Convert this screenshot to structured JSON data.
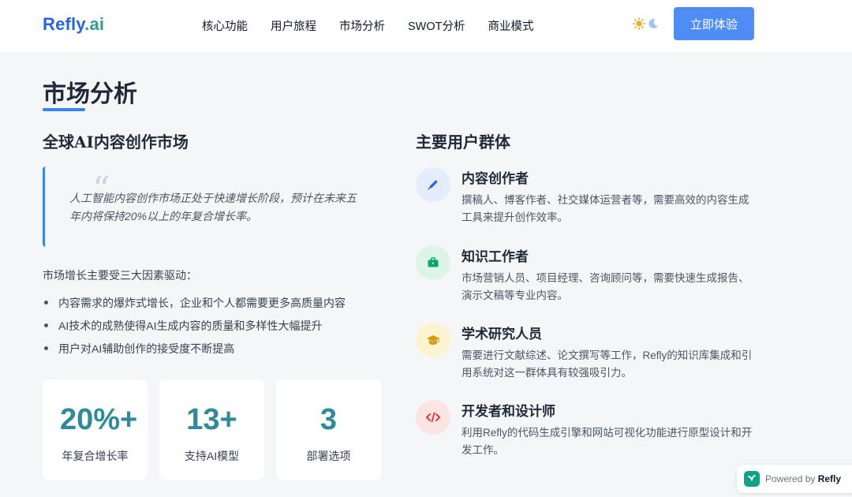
{
  "header": {
    "logo_main": "Refly",
    "logo_suffix": ".ai",
    "nav": [
      "核心功能",
      "用户旅程",
      "市场分析",
      "SWOT分析",
      "商业模式"
    ],
    "cta_label": "立即体验"
  },
  "section": {
    "title": "市场分析"
  },
  "market": {
    "heading": "全球AI内容创作市场",
    "quote": "人工智能内容创作市场正处于快速增长阶段，预计在未来五年内将保持20%以上的年复合增长率。",
    "drivers_intro": "市场增长主要受三大因素驱动：",
    "drivers": [
      "内容需求的爆炸式增长，企业和个人都需要更多高质量内容",
      "AI技术的成熟使得AI生成内容的质量和多样性大幅提升",
      "用户对AI辅助创作的接受度不断提高"
    ],
    "stats": [
      {
        "value": "20%+",
        "label": "年复合增长率"
      },
      {
        "value": "13+",
        "label": "支持AI模型"
      },
      {
        "value": "3",
        "label": "部署选项"
      }
    ]
  },
  "audience": {
    "heading": "主要用户群体",
    "groups": [
      {
        "title": "内容创作者",
        "desc": "撰稿人、博客作者、社交媒体运营者等，需要高效的内容生成工具来提升创作效率。",
        "icon": "pen-icon",
        "bg": "#e3edfc",
        "fg": "#2563eb"
      },
      {
        "title": "知识工作者",
        "desc": "市场营销人员、项目经理、咨询顾问等，需要快速生成报告、演示文稿等专业内容。",
        "icon": "briefcase-icon",
        "bg": "#dcf5e8",
        "fg": "#10a36a"
      },
      {
        "title": "学术研究人员",
        "desc": "需要进行文献综述、论文撰写等工作，Refly的知识库集成和引用系统对这一群体具有较强吸引力。",
        "icon": "graduation-cap-icon",
        "bg": "#fdf3d1",
        "fg": "#d49a0a"
      },
      {
        "title": "开发者和设计师",
        "desc": "利用Refly的代码生成引擎和网站可视化功能进行原型设计和开发工作。",
        "icon": "code-icon",
        "bg": "#fde4e4",
        "fg": "#dc2626"
      }
    ]
  },
  "badge": {
    "prefix": "Powered by",
    "brand": "Refly"
  },
  "colors": {
    "accent": "#3b82f6",
    "cta": "#4f8df5",
    "stat": "#2f8a9a"
  }
}
